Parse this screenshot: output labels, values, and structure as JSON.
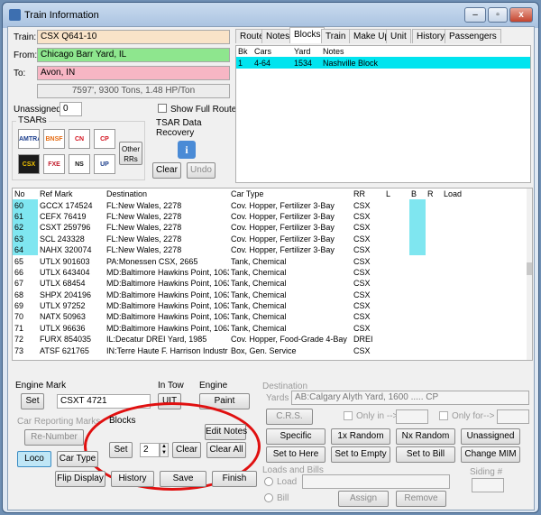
{
  "window": {
    "title": "Train Information",
    "controls": [
      "–",
      "▫",
      "x"
    ]
  },
  "train": {
    "train_label": "Train:",
    "train_value": "CSX Q641-10",
    "from_label": "From:",
    "from_value": "Chicago Barr Yard, IL",
    "to_label": "To:",
    "to_value": "Avon, IN",
    "stats": "7597', 9300 Tons, 1.48 HP/Ton",
    "unassigned_label": "Unassigned:",
    "unassigned_value": "0",
    "show_full_route": "Show Full Route"
  },
  "tsars": {
    "title": "TSARs",
    "logos": [
      {
        "text": "AMTRAK",
        "bg": "#ffffff",
        "fg": "#1a3c8c"
      },
      {
        "text": "BNSF",
        "bg": "#ffffff",
        "fg": "#e56a10"
      },
      {
        "text": "CN",
        "bg": "#ffffff",
        "fg": "#d4121e"
      },
      {
        "text": "CP",
        "bg": "#ffffff",
        "fg": "#d4121e"
      },
      {
        "text": "CSX",
        "bg": "#1b1b1b",
        "fg": "#f2c200"
      },
      {
        "text": "FXE",
        "bg": "#ffffff",
        "fg": "#c21f2e"
      },
      {
        "text": "NS",
        "bg": "#ffffff",
        "fg": "#111111"
      },
      {
        "text": "UP",
        "bg": "#ffffff",
        "fg": "#1c3f8c"
      }
    ],
    "other": "Other RRs",
    "recovery_title": "TSAR Data Recovery",
    "info_icon": "i",
    "clear": "Clear",
    "undo": "Undo"
  },
  "tabs": [
    "Route",
    "Notes",
    "Blocks",
    "Train",
    "Make Up",
    "Unit",
    "History",
    "Passengers"
  ],
  "active_tab": "Blocks",
  "blocks_table": {
    "headers": [
      "Bk",
      "Cars",
      "Yard",
      "Notes"
    ],
    "rows": [
      [
        "1",
        "4-64",
        "1534",
        "Nashville Block"
      ]
    ]
  },
  "cars_table": {
    "headers": [
      "No",
      "Ref Mark",
      "Destination",
      "Car Type",
      "RR",
      "L",
      "B",
      "R",
      "Load"
    ],
    "rows": [
      [
        "60",
        "GCCX 174524",
        "FL:New Wales, 2278",
        "Cov. Hopper, Fertilizer 3-Bay",
        "CSX"
      ],
      [
        "61",
        "CEFX 76419",
        "FL:New Wales, 2278",
        "Cov. Hopper, Fertilizer 3-Bay",
        "CSX"
      ],
      [
        "62",
        "CSXT 259796",
        "FL:New Wales, 2278",
        "Cov. Hopper, Fertilizer 3-Bay",
        "CSX"
      ],
      [
        "63",
        "SCL 243328",
        "FL:New Wales, 2278",
        "Cov. Hopper, Fertilizer 3-Bay",
        "CSX"
      ],
      [
        "64",
        "NAHX 320074",
        "FL:New Wales, 2278",
        "Cov. Hopper, Fertilizer 3-Bay",
        "CSX"
      ],
      [
        "65",
        "UTLX 901603",
        "PA:Monessen CSX, 2665",
        "Tank, Chemical",
        "CSX"
      ],
      [
        "66",
        "UTLX 643404",
        "MD:Baltimore Hawkins Point, 1063",
        "Tank, Chemical",
        "CSX"
      ],
      [
        "67",
        "UTLX 68454",
        "MD:Baltimore Hawkins Point, 1063",
        "Tank, Chemical",
        "CSX"
      ],
      [
        "68",
        "SHPX 204196",
        "MD:Baltimore Hawkins Point, 1063",
        "Tank, Chemical",
        "CSX"
      ],
      [
        "69",
        "UTLX 97252",
        "MD:Baltimore Hawkins Point, 1063",
        "Tank, Chemical",
        "CSX"
      ],
      [
        "70",
        "NATX 50963",
        "MD:Baltimore Hawkins Point, 1063",
        "Tank, Chemical",
        "CSX"
      ],
      [
        "71",
        "UTLX 96636",
        "MD:Baltimore Hawkins Point, 1063",
        "Tank, Chemical",
        "CSX"
      ],
      [
        "72",
        "FURX 854035",
        "IL:Decatur DREI Yard, 1985",
        "Cov. Hopper, Food-Grade 4-Bay",
        "DREI"
      ],
      [
        "73",
        "ATSF 621765",
        "IN:Terre Haute F. Harrison Industr",
        "Box, Gen. Service",
        "CSX"
      ]
    ],
    "highlighted": [
      0,
      1,
      2,
      3,
      4
    ],
    "highlight_color": "#7fe6f0"
  },
  "engine_mark": {
    "title": "Engine Mark",
    "set": "Set",
    "value": "CSXT 4721"
  },
  "in_tow": {
    "title": "In Tow",
    "btn": "UIT"
  },
  "engine": {
    "title": "Engine",
    "btn": "Paint"
  },
  "car_marks": {
    "title": "Car Reporting Marks",
    "renumber": "Re-Number"
  },
  "blocks_panel": {
    "title": "Blocks",
    "edit_notes": "Edit Notes",
    "set": "Set",
    "stepper_value": "2",
    "clear": "Clear",
    "clear_all": "Clear All"
  },
  "loco": "Loco",
  "car_type": "Car Type",
  "bottom_buttons": [
    "Flip Display",
    "History",
    "Save",
    "Finish"
  ],
  "destination": {
    "title": "Destination",
    "yards_label": "Yards",
    "yards_value": "AB:Calgary Alyth Yard, 1600 ..... CP",
    "crs": "C.R.S.",
    "only_in": "Only in -->",
    "only_for": "Only for-->",
    "buttons": [
      "Specific",
      "1x Random",
      "Nx Random",
      "Unassigned",
      "Set to Here",
      "Set to Empty",
      "Set to Bill",
      "Change MIM"
    ]
  },
  "loads": {
    "title": "Loads and Bills",
    "load": "Load",
    "bill": "Bill",
    "assign": "Assign",
    "remove": "Remove"
  },
  "siding": {
    "title": "Siding #"
  }
}
